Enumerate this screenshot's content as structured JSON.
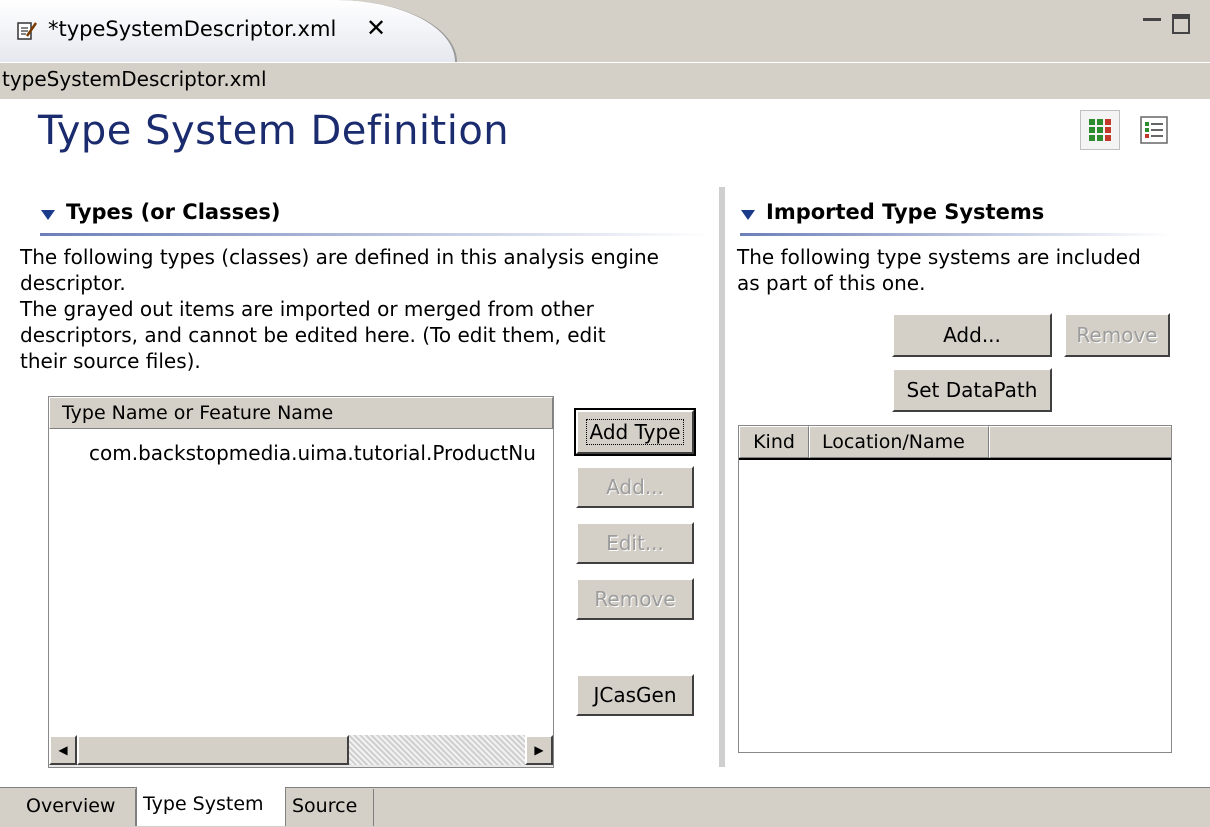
{
  "editor_tab": {
    "title": "*typeSystemDescriptor.xml",
    "close_glyph": "✕",
    "icon": "edit-file-icon"
  },
  "breadcrumb": "typeSystemDescriptor.xml",
  "page_title": "Type System Definition",
  "types_section": {
    "title": "Types (or Classes)",
    "desc_lines": [
      "The following types (classes) are defined in this analysis engine",
      "descriptor.",
      "The grayed out items are imported or merged from other",
      "descriptors, and cannot be edited here. (To edit them, edit",
      "their source files)."
    ],
    "column_header": "Type Name or Feature Name",
    "rows": [
      "com.backstopmedia.uima.tutorial.ProductNu"
    ],
    "buttons": {
      "add_type": "Add Type",
      "add": "Add...",
      "edit": "Edit...",
      "remove": "Remove",
      "jcasgen": "JCasGen"
    }
  },
  "imported_section": {
    "title": "Imported Type Systems",
    "desc_lines": [
      "The following type systems are included",
      "as part of this one."
    ],
    "buttons": {
      "add": "Add...",
      "remove": "Remove",
      "set_datapath": "Set DataPath"
    },
    "columns": [
      "Kind",
      "Location/Name"
    ]
  },
  "bottom_tabs": [
    "Overview",
    "Type System",
    "Source"
  ],
  "active_bottom_tab": "Type System",
  "colors": {
    "title_blue": "#1a2b6e",
    "chrome_gray": "#d4d0c8",
    "section_rule": "#6c7fb8"
  }
}
